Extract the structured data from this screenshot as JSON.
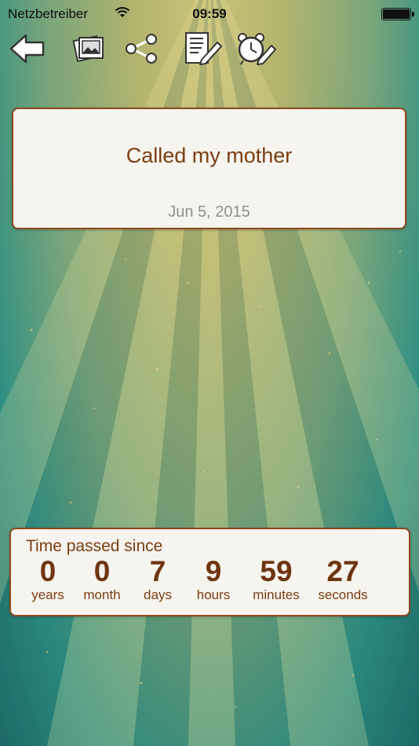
{
  "status_bar": {
    "carrier": "Netzbetreiber",
    "time": "09:59"
  },
  "toolbar": {
    "items": [
      {
        "name": "back",
        "icon": "back-arrow-icon"
      },
      {
        "name": "photos",
        "icon": "photos-icon"
      },
      {
        "name": "share",
        "icon": "share-icon"
      },
      {
        "name": "edit-note",
        "icon": "edit-note-icon"
      },
      {
        "name": "edit-reminder",
        "icon": "alarm-clock-edit-icon"
      }
    ]
  },
  "event": {
    "title": "Called my mother",
    "date": "Jun 5, 2015"
  },
  "timer": {
    "label": "Time passed since",
    "units": [
      {
        "value": "0",
        "label": "years"
      },
      {
        "value": "0",
        "label": "month"
      },
      {
        "value": "7",
        "label": "days"
      },
      {
        "value": "9",
        "label": "hours"
      },
      {
        "value": "59",
        "label": "minutes"
      },
      {
        "value": "27",
        "label": "seconds"
      }
    ]
  },
  "colors": {
    "accent_brown": "#7b3d12",
    "card_bg": "#f6f4ee",
    "date_gray": "#8f8f8f"
  }
}
